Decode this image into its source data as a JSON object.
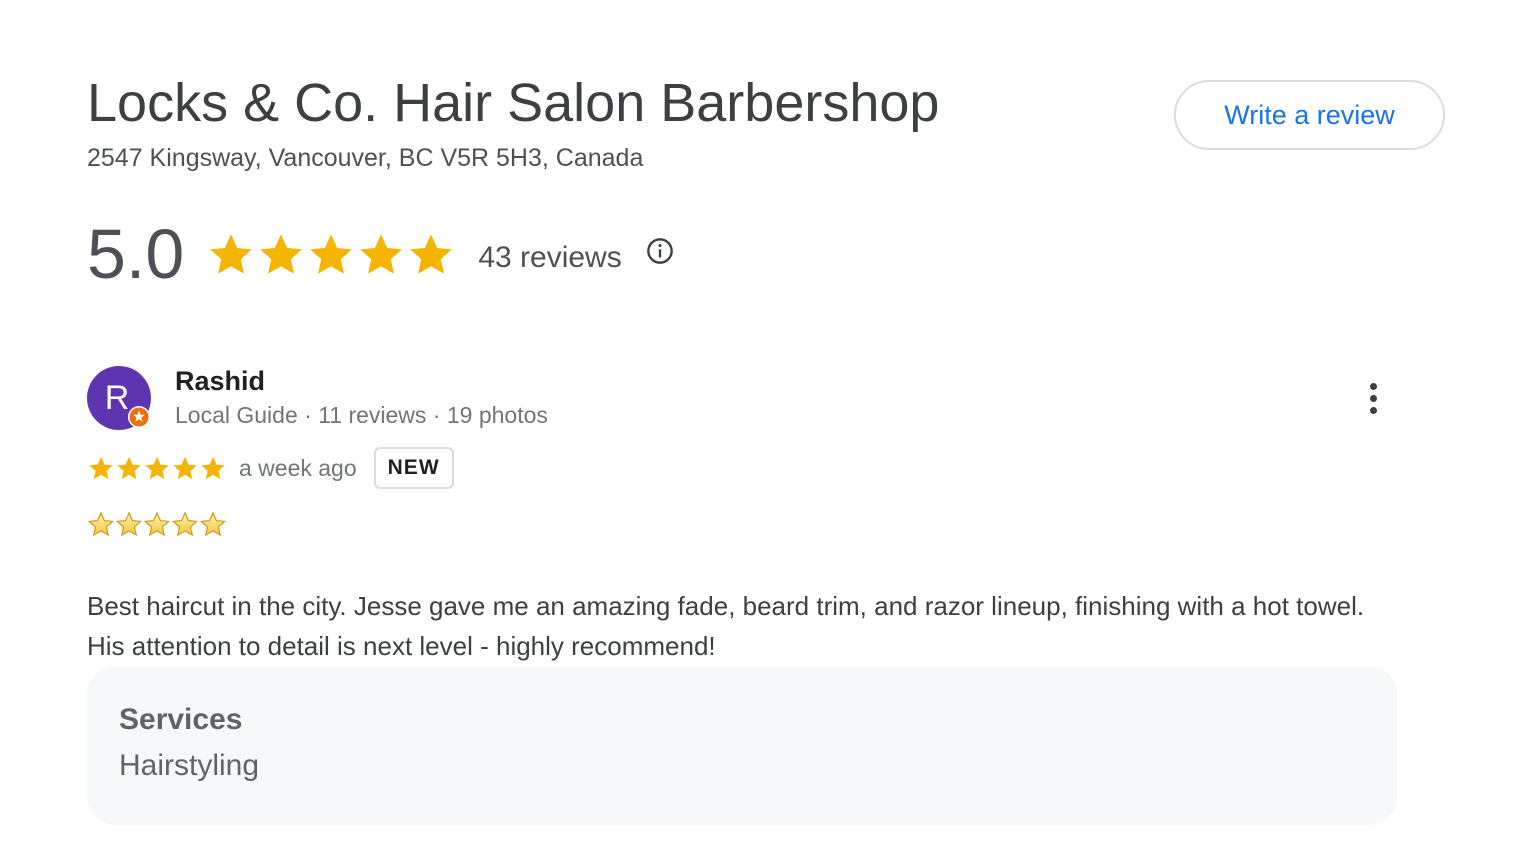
{
  "business": {
    "name": "Locks & Co. Hair Salon Barbershop",
    "address": "2547 Kingsway, Vancouver, BC V5R 5H3, Canada",
    "write_review_label": "Write a review"
  },
  "summary": {
    "rating": "5.0",
    "stars": 5,
    "review_count": "43 reviews"
  },
  "review": {
    "avatar_initial": "R",
    "avatar_color": "#5e35b1",
    "reviewer_name": "Rashid",
    "reviewer_meta": "Local Guide · 11 reviews · 19 photos",
    "stars": 5,
    "time": "a week ago",
    "badge": "NEW",
    "text": "Best haircut in the city. Jesse gave me an amazing fade, beard trim, and razor lineup, finishing with a hot towel. His attention to detail is next level - highly recommend!",
    "services_label": "Services",
    "services_value": "Hairstyling"
  },
  "colors": {
    "star": "#f4b400",
    "link": "#1a73e8",
    "badge_orange": "#e8710a"
  },
  "icons": [
    "star-icon",
    "info-icon",
    "local-guide-badge-icon",
    "more-vert-icon",
    "star-emoji-icon"
  ]
}
